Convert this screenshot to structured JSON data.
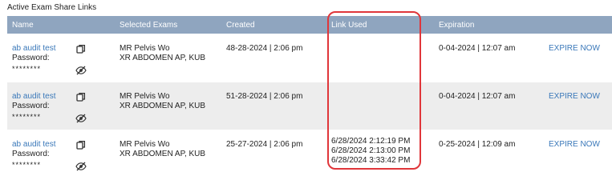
{
  "section_title": "Active Exam Share Links",
  "columns": {
    "name": "Name",
    "selected_exams": "Selected Exams",
    "created": "Created",
    "link_used": "Link Used",
    "expiration": "Expiration"
  },
  "rows": [
    {
      "name": "ab audit test",
      "password_label": "Password:",
      "password_mask": "********",
      "exams": [
        "MR Pelvis Wo",
        "XR ABDOMEN AP, KUB"
      ],
      "created": "48-28-2024 | 2:06 pm",
      "link_used": [],
      "expiration": "0-04-2024 | 12:07 am",
      "action": "EXPIRE NOW"
    },
    {
      "name": "ab audit test",
      "password_label": "Password:",
      "password_mask": "********",
      "exams": [
        "MR Pelvis Wo",
        "XR ABDOMEN AP, KUB"
      ],
      "created": "51-28-2024 | 2:06 pm",
      "link_used": [],
      "expiration": "0-04-2024 | 12:07 am",
      "action": "EXPIRE NOW"
    },
    {
      "name": "ab audit test",
      "password_label": "Password:",
      "password_mask": "********",
      "exams": [
        "MR Pelvis Wo",
        "XR ABDOMEN AP, KUB"
      ],
      "created": "25-27-2024 | 2:06 pm",
      "link_used": [
        "6/28/2024 2:12:19 PM",
        "6/28/2024 2:13:00 PM",
        "6/28/2024 3:33:42 PM"
      ],
      "expiration": "0-25-2024 | 12:09 am",
      "action": "EXPIRE NOW"
    }
  ],
  "icons": {
    "copy": "copy-icon",
    "visibility": "eye-slash-icon"
  },
  "colors": {
    "header_bg": "#8fa5bf",
    "header_text": "#ffffff",
    "link": "#3a78b9",
    "alt_row": "#ededed",
    "highlight": "#e0363a"
  }
}
